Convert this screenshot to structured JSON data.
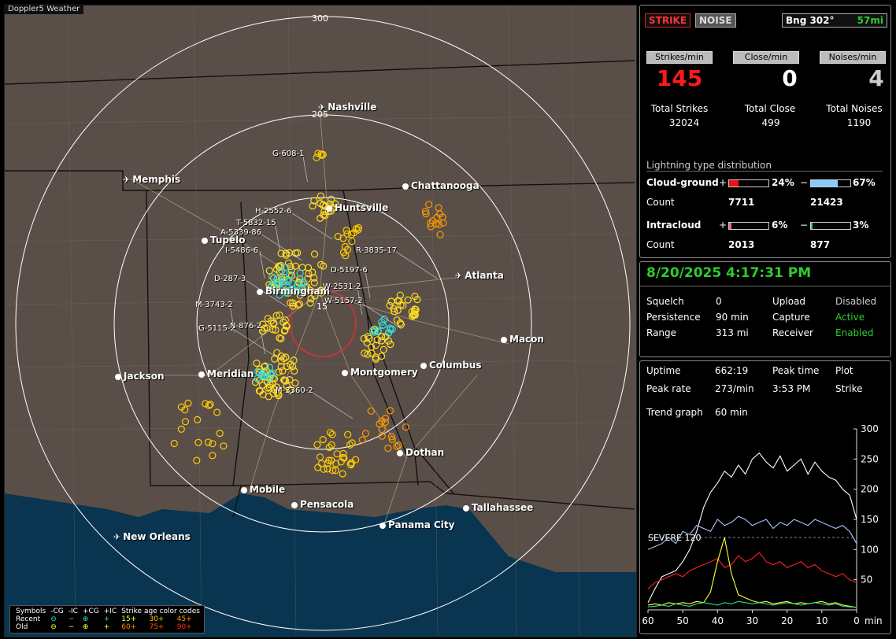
{
  "app": {
    "title": "Doppler5 Weather"
  },
  "map": {
    "range_labels": [
      "300",
      "205",
      "15"
    ],
    "cities": [
      {
        "name": "Nashville",
        "marker": "plane"
      },
      {
        "name": "Memphis",
        "marker": "plane"
      },
      {
        "name": "Chattanooga",
        "marker": "dot"
      },
      {
        "name": "Huntsville",
        "marker": "dot"
      },
      {
        "name": "Tupelo",
        "marker": "dot"
      },
      {
        "name": "Atlanta",
        "marker": "plane"
      },
      {
        "name": "Birmingham",
        "marker": "dot"
      },
      {
        "name": "Macon",
        "marker": "dot"
      },
      {
        "name": "Jackson",
        "marker": "dot"
      },
      {
        "name": "Meridian",
        "marker": "dot"
      },
      {
        "name": "Montgomery",
        "marker": "dot"
      },
      {
        "name": "Columbus",
        "marker": "dot"
      },
      {
        "name": "Dothan",
        "marker": "dot"
      },
      {
        "name": "Mobile",
        "marker": "dot"
      },
      {
        "name": "Pensacola",
        "marker": "dot"
      },
      {
        "name": "Tallahassee",
        "marker": "dot"
      },
      {
        "name": "Panama City",
        "marker": "dot"
      },
      {
        "name": "New Orleans",
        "marker": "plane"
      }
    ],
    "strike_labels": [
      "G-608-1",
      "H-2552-6",
      "T-5832-15",
      "A-5339-86",
      "I-5486-6",
      "R-3835-17",
      "D-5197-6",
      "D-287-3",
      "W-2531-2",
      "W-5157-2",
      "M-3743-2",
      "G-5115-2",
      "N-876-2",
      "M-3360-2"
    ],
    "legend": {
      "header": [
        "Symbols",
        "-CG",
        "-IC",
        "+CG",
        "+IC",
        "Strike age color codes"
      ],
      "recent_label": "Recent",
      "old_label": "Old",
      "recent_ages": [
        "15+",
        "30+",
        "45+"
      ],
      "old_ages": [
        "60+",
        "75+",
        "90+"
      ],
      "age_colors": [
        "#ffff33",
        "#ffcc00",
        "#ff9900",
        "#ff8800",
        "#ff5500",
        "#ff3300"
      ]
    }
  },
  "status": {
    "strike_btn": "STRIKE",
    "noise_btn": "NOISE",
    "bearing": "Bng 302°",
    "distance": "57mi",
    "strikes_per_min_label": "Strikes/min",
    "close_per_min_label": "Close/min",
    "noises_per_min_label": "Noises/min",
    "strikes_per_min": "145",
    "close_per_min": "0",
    "noises_per_min": "4",
    "total_strikes_label": "Total Strikes",
    "total_close_label": "Total Close",
    "total_noises_label": "Total Noises",
    "total_strikes": "32024",
    "total_close": "499",
    "total_noises": "1190",
    "dist_title": "Lightning type distribution",
    "cg_label": "Cloud-ground",
    "ic_label": "Intracloud",
    "count_label": "Count",
    "plus": "+",
    "minus": "−",
    "cg_pos_pct": "24%",
    "cg_neg_pct": "67%",
    "cg_pos_count": "7711",
    "cg_neg_count": "21423",
    "ic_pos_pct": "6%",
    "ic_neg_pct": "3%",
    "ic_pos_count": "2013",
    "ic_neg_count": "877",
    "cg_pos_frac": 0.24,
    "cg_neg_frac": 0.67,
    "ic_pos_frac": 0.06,
    "ic_neg_frac": 0.03,
    "colors": {
      "cg_pos": "#ee1111",
      "cg_neg": "#88ccff",
      "ic_pos": "#ee66aa",
      "ic_neg": "#22dd88",
      "strike": "#ff1a1a"
    }
  },
  "settings": {
    "timestamp": "8/20/2025 4:17:31 PM",
    "squelch_label": "Squelch",
    "squelch": "0",
    "persistence_label": "Persistence",
    "persistence": "90 min",
    "range_label": "Range",
    "range": "313 mi",
    "upload_label": "Upload",
    "upload": "Disabled",
    "capture_label": "Capture",
    "capture": "Active",
    "receiver_label": "Receiver",
    "receiver": "Enabled"
  },
  "trend": {
    "uptime_label": "Uptime",
    "uptime": "662:19",
    "peak_time_label": "Peak time",
    "peak_time": "3:53 PM",
    "plot_label": "Plot",
    "plot": "Strike",
    "peak_rate_label": "Peak rate",
    "peak_rate": "273/min",
    "trend_label": "Trend graph",
    "trend_value": "60 min",
    "severe_label": "SEVERE 120"
  },
  "chart_data": {
    "type": "line",
    "x": [
      60,
      58,
      56,
      54,
      52,
      50,
      48,
      46,
      44,
      42,
      40,
      38,
      36,
      34,
      32,
      30,
      28,
      26,
      24,
      22,
      20,
      18,
      16,
      14,
      12,
      10,
      8,
      6,
      4,
      2,
      0
    ],
    "xlabel": "min",
    "x_ticks": [
      "60",
      "50",
      "40",
      "30",
      "20",
      "10",
      "0"
    ],
    "y_ticks": [
      "300",
      "250",
      "200",
      "150",
      "100",
      "50"
    ],
    "xlim": [
      60,
      0
    ],
    "ylim": [
      0,
      300
    ],
    "severe_threshold": 120,
    "series": [
      {
        "color": "#ffffff",
        "values": [
          12,
          35,
          55,
          60,
          65,
          80,
          100,
          130,
          170,
          195,
          210,
          230,
          220,
          240,
          225,
          250,
          260,
          245,
          235,
          255,
          230,
          240,
          250,
          225,
          245,
          230,
          220,
          215,
          200,
          190,
          150
        ]
      },
      {
        "color": "#a8c8ff",
        "values": [
          100,
          105,
          110,
          120,
          110,
          130,
          125,
          140,
          135,
          130,
          150,
          140,
          145,
          155,
          150,
          140,
          145,
          150,
          135,
          145,
          140,
          150,
          145,
          140,
          150,
          145,
          140,
          135,
          140,
          130,
          110
        ]
      },
      {
        "color": "#ff2020",
        "values": [
          35,
          45,
          50,
          55,
          60,
          55,
          65,
          70,
          75,
          80,
          85,
          70,
          75,
          90,
          80,
          85,
          95,
          80,
          75,
          80,
          70,
          75,
          80,
          70,
          75,
          65,
          60,
          55,
          60,
          50,
          45
        ]
      },
      {
        "color": "#ffff33",
        "values": [
          8,
          10,
          8,
          12,
          10,
          12,
          10,
          14,
          12,
          30,
          80,
          120,
          60,
          25,
          20,
          15,
          12,
          14,
          10,
          12,
          14,
          10,
          12,
          10,
          12,
          14,
          10,
          12,
          8,
          6,
          4
        ]
      },
      {
        "color": "#22dd88",
        "values": [
          5,
          6,
          8,
          6,
          10,
          8,
          6,
          10,
          12,
          10,
          8,
          12,
          10,
          14,
          12,
          10,
          12,
          10,
          8,
          10,
          12,
          10,
          8,
          10,
          12,
          10,
          8,
          10,
          6,
          5,
          4
        ]
      }
    ]
  }
}
